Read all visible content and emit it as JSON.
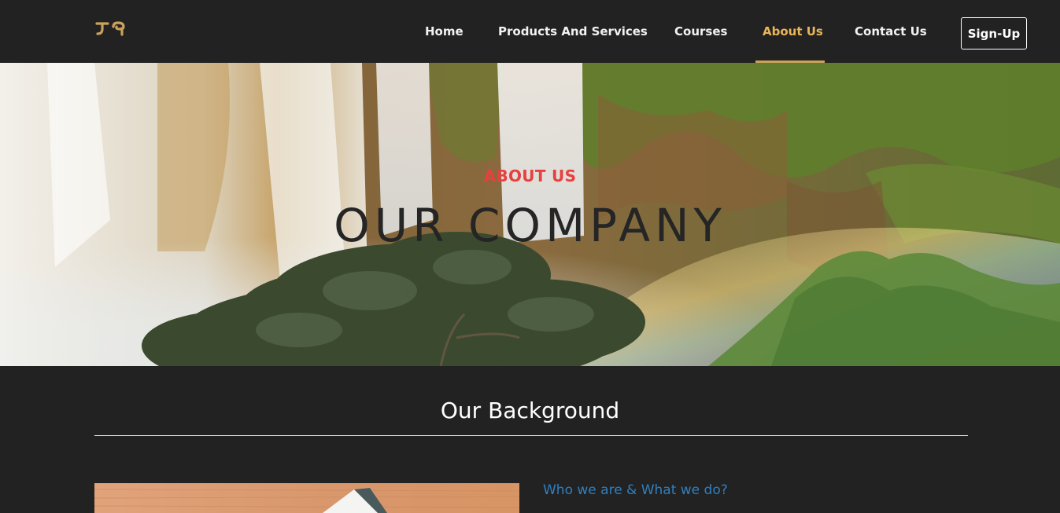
{
  "brand": {
    "logo_icon": "ethiopic-logo-icon",
    "accent_color": "#c9a25b"
  },
  "nav": {
    "items": [
      {
        "label": "Home",
        "active": false
      },
      {
        "label": "Products And Services",
        "active": false
      },
      {
        "label": "Courses",
        "active": false
      },
      {
        "label": "About Us",
        "active": true
      },
      {
        "label": "Contact Us",
        "active": false
      }
    ],
    "signup_label": "Sign-Up",
    "active_color": "#e9b65a"
  },
  "hero": {
    "kicker": "ABOUT US",
    "title": "OUR COMPANY",
    "kicker_color": "#e8403f",
    "background": "waterfall-photo"
  },
  "background_section": {
    "title": "Our Background",
    "subheading": "Who we are & What we do?",
    "subheading_color": "#2f7fbf",
    "image": "desk-photo"
  }
}
